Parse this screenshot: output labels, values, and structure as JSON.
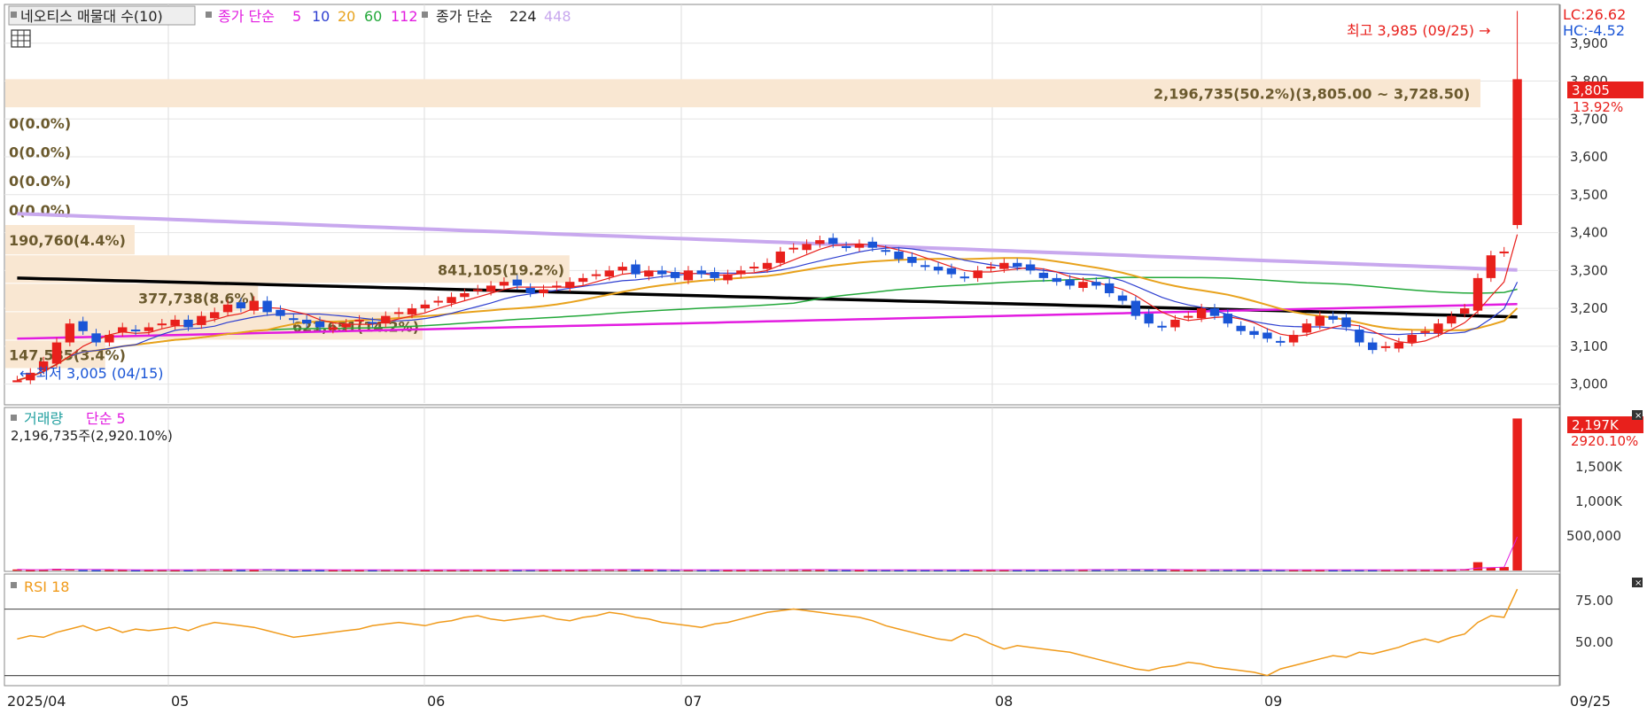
{
  "price_legend": {
    "title": "네오티스 매물대 수(10)",
    "ma_label": "종가 단순",
    "ma_periods": [
      "5",
      "10",
      "20",
      "60",
      "112"
    ],
    "ma2_label": "종가 단순",
    "ma2_periods": [
      "224",
      "448"
    ]
  },
  "price_axis": {
    "ticks": [
      "3,000",
      "3,100",
      "3,200",
      "3,300",
      "3,400",
      "3,500",
      "3,600",
      "3,700",
      "3,800",
      "3,900"
    ],
    "lc": "LC:26.62",
    "hc": "HC:-4.52",
    "current_price": "3,805",
    "current_change": "13.92%"
  },
  "annotations": {
    "high": "최고 3,985 (09/25) →",
    "low": "← 최저 3,005 (04/15)"
  },
  "volume_profile": [
    {
      "label": "2,196,735(50.2%)(3,805.00 ~ 3,728.50)",
      "low": 3728.5,
      "high": 3805,
      "pct": 50.2
    },
    {
      "label": "0(0.0%)",
      "low": 3650,
      "high": 3728.5,
      "pct": 0
    },
    {
      "label": "0(0.0%)",
      "low": 3575,
      "high": 3650,
      "pct": 0
    },
    {
      "label": "0(0.0%)",
      "low": 3500,
      "high": 3575,
      "pct": 0
    },
    {
      "label": "0(0.0%)",
      "low": 3420,
      "high": 3500,
      "pct": 0
    },
    {
      "label": "190,760(4.4%)",
      "low": 3340,
      "high": 3420,
      "pct": 4.4
    },
    {
      "label": "841,105(19.2%)",
      "low": 3265,
      "high": 3340,
      "pct": 19.2
    },
    {
      "label": "377,738(8.6%)",
      "low": 3190,
      "high": 3265,
      "pct": 8.6
    },
    {
      "label": "621,651(14.2%)",
      "low": 3115,
      "high": 3190,
      "pct": 14.2
    },
    {
      "label": "147,585(3.4%)",
      "low": 3040,
      "high": 3115,
      "pct": 3.4
    }
  ],
  "volume_panel": {
    "legend": "거래량",
    "ma_label": "단순 5",
    "summary": "2,196,735주(2,920.10%)",
    "ticks": [
      "500,000",
      "1,000K",
      "1,500K"
    ],
    "current": "2,197K",
    "current_pct": "2920.10%"
  },
  "rsi_panel": {
    "legend": "RSI 18",
    "ticks": [
      "50.00",
      "75.00"
    ]
  },
  "x_axis": {
    "labels": [
      "2025/04",
      "05",
      "06",
      "07",
      "08",
      "09"
    ],
    "last": "09/25"
  },
  "colors": {
    "up": "#e8201c",
    "down": "#1a55d6",
    "ma5": "#e8201c",
    "ma10": "#2e3fd0",
    "ma20": "#e8a21c",
    "ma60": "#23a83a",
    "ma112": "#e21ce0",
    "ma224": "#000000",
    "ma448": "#c8a8ee",
    "rsi": "#f09a1a",
    "profile": "#f9e7d2"
  },
  "chart_data": {
    "type": "candlestick",
    "date_range": [
      "2025/04",
      "09/25"
    ],
    "price_range": [
      2950,
      4000
    ],
    "high": {
      "value": 3985,
      "date": "09/25"
    },
    "low": {
      "value": 3005,
      "date": "04/15"
    },
    "close": [
      3010,
      3030,
      3060,
      3110,
      3160,
      3140,
      3110,
      3130,
      3150,
      3140,
      3150,
      3160,
      3170,
      3150,
      3180,
      3190,
      3210,
      3200,
      3220,
      3190,
      3180,
      3170,
      3160,
      3150,
      3150,
      3160,
      3170,
      3160,
      3180,
      3190,
      3200,
      3210,
      3220,
      3230,
      3240,
      3250,
      3260,
      3270,
      3260,
      3240,
      3250,
      3260,
      3270,
      3280,
      3290,
      3300,
      3310,
      3290,
      3300,
      3290,
      3280,
      3300,
      3290,
      3280,
      3290,
      3300,
      3310,
      3320,
      3350,
      3360,
      3370,
      3380,
      3370,
      3360,
      3370,
      3360,
      3350,
      3330,
      3320,
      3310,
      3300,
      3290,
      3280,
      3300,
      3310,
      3320,
      3310,
      3300,
      3280,
      3270,
      3260,
      3270,
      3260,
      3240,
      3220,
      3180,
      3160,
      3150,
      3170,
      3180,
      3200,
      3180,
      3160,
      3140,
      3130,
      3120,
      3110,
      3130,
      3160,
      3180,
      3170,
      3150,
      3110,
      3090,
      3100,
      3110,
      3130,
      3140,
      3160,
      3180,
      3200,
      3280,
      3340,
      3350,
      3805
    ],
    "volume": [
      15000,
      9000,
      12000,
      24000,
      18000,
      9000,
      8000,
      10000,
      11000,
      8000,
      9000,
      12000,
      10000,
      8000,
      15000,
      18000,
      11000,
      9000,
      8000,
      20000,
      14000,
      9000,
      8000,
      7000,
      9000,
      10000,
      8000,
      9000,
      12000,
      11000,
      9000,
      8000,
      9000,
      10000,
      11000,
      9000,
      8000,
      9000,
      10000,
      12000,
      11000,
      9000,
      10000,
      12000,
      14000,
      15000,
      13000,
      10000,
      9000,
      10000,
      11000,
      12000,
      10000,
      9000,
      8000,
      9000,
      11000,
      12000,
      14000,
      13000,
      12000,
      11000,
      10000,
      9000,
      8000,
      9000,
      10000,
      9000,
      8000,
      9000,
      10000,
      8000,
      7000,
      9000,
      10000,
      11000,
      9000,
      8000,
      10000,
      12000,
      14000,
      13000,
      12000,
      15000,
      16000,
      14000,
      13000,
      12000,
      10000,
      9000,
      11000,
      13000,
      12000,
      11000,
      10000,
      9000,
      12000,
      11000,
      10000,
      9000,
      8000,
      9000,
      10000,
      9000,
      11000,
      12000,
      13000,
      11000,
      10000,
      12000,
      20000,
      120000,
      40000,
      50000,
      2196735
    ],
    "rsi": [
      52,
      54,
      53,
      56,
      58,
      60,
      57,
      59,
      56,
      58,
      57,
      58,
      59,
      57,
      60,
      62,
      61,
      60,
      59,
      57,
      55,
      53,
      54,
      55,
      56,
      57,
      58,
      60,
      61,
      62,
      61,
      60,
      62,
      63,
      65,
      66,
      64,
      63,
      64,
      65,
      66,
      64,
      63,
      65,
      66,
      68,
      67,
      65,
      64,
      62,
      61,
      60,
      59,
      61,
      62,
      64,
      66,
      68,
      69,
      70,
      69,
      68,
      67,
      66,
      65,
      63,
      60,
      58,
      56,
      54,
      52,
      51,
      55,
      53,
      49,
      46,
      48,
      47,
      46,
      45,
      44,
      42,
      40,
      38,
      36,
      34,
      33,
      35,
      36,
      38,
      37,
      35,
      34,
      33,
      32,
      30,
      34,
      36,
      38,
      40,
      42,
      41,
      44,
      43,
      45,
      47,
      50,
      52,
      50,
      53,
      55,
      62,
      66,
      65,
      82
    ]
  }
}
